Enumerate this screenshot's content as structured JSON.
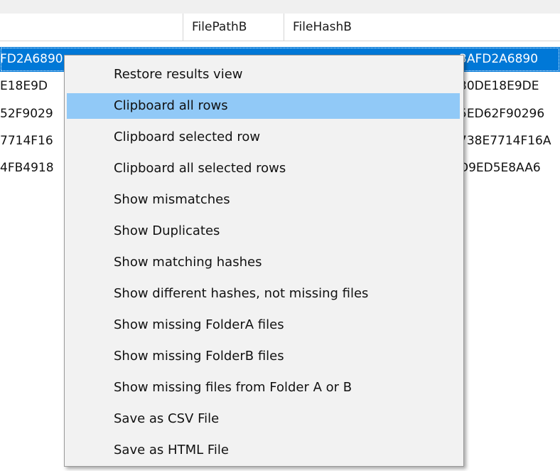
{
  "grid": {
    "columns": [
      {
        "label": ""
      },
      {
        "label": "FilePathB"
      },
      {
        "label": "FileHashB"
      }
    ],
    "rows": [
      {
        "left": "FD2A6890",
        "right": "3AFD2A6890",
        "selected": true
      },
      {
        "left": "E18E9D",
        "right": "30DE18E9DE",
        "selected": false
      },
      {
        "left": "52F9029",
        "right": "5ED62F90296",
        "selected": false
      },
      {
        "left": "7714F16",
        "right": "738E7714F16A",
        "selected": false
      },
      {
        "left": "4FB4918",
        "right": "D9ED5E8AA6",
        "selected": false
      }
    ]
  },
  "context_menu": {
    "items": [
      {
        "label": "Restore results view",
        "highlighted": false
      },
      {
        "label": "Clipboard all rows",
        "highlighted": true
      },
      {
        "label": "Clipboard selected row",
        "highlighted": false
      },
      {
        "label": "Clipboard all selected rows",
        "highlighted": false
      },
      {
        "label": "Show mismatches",
        "highlighted": false
      },
      {
        "label": "Show Duplicates",
        "highlighted": false
      },
      {
        "label": "Show matching hashes",
        "highlighted": false
      },
      {
        "label": "Show different hashes, not missing files",
        "highlighted": false
      },
      {
        "label": "Show missing FolderA files",
        "highlighted": false
      },
      {
        "label": "Show missing FolderB files",
        "highlighted": false
      },
      {
        "label": "Show missing files from Folder A or B",
        "highlighted": false
      },
      {
        "label": "Save as CSV File",
        "highlighted": false
      },
      {
        "label": "Save as HTML File",
        "highlighted": false
      }
    ]
  },
  "colors": {
    "selection": "#0078d7",
    "menu_hover": "#91c9f7",
    "menu_background": "#f2f2f2"
  }
}
